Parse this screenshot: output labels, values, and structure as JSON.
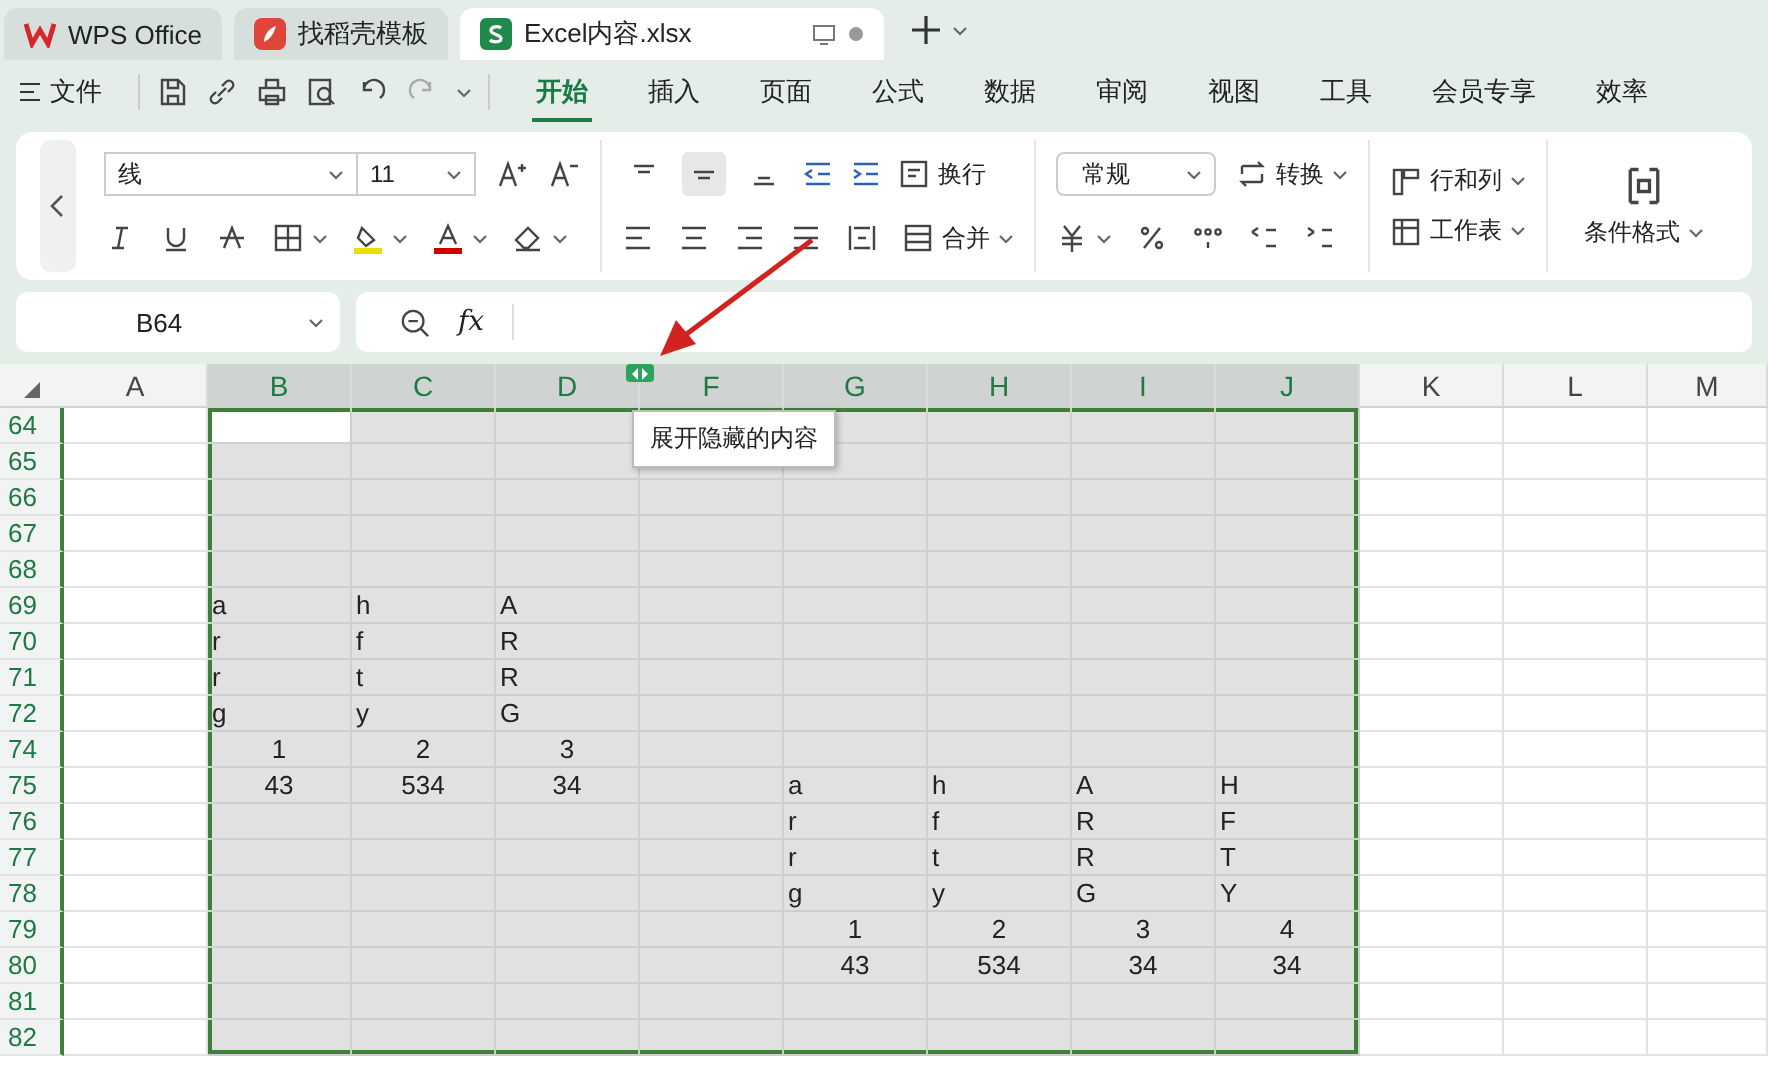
{
  "tabs": [
    {
      "label": "WPS Office",
      "kind": "wps",
      "selected": false
    },
    {
      "label": "找稻壳模板",
      "kind": "docer",
      "selected": false
    },
    {
      "label": "Excel内容.xlsx",
      "kind": "sheet",
      "selected": true
    }
  ],
  "menu": {
    "file": "文件",
    "items": [
      {
        "label": "开始",
        "selected": true
      },
      {
        "label": "插入",
        "selected": false
      },
      {
        "label": "页面",
        "selected": false
      },
      {
        "label": "公式",
        "selected": false
      },
      {
        "label": "数据",
        "selected": false
      },
      {
        "label": "审阅",
        "selected": false
      },
      {
        "label": "视图",
        "selected": false
      },
      {
        "label": "工具",
        "selected": false
      },
      {
        "label": "会员专享",
        "selected": false
      },
      {
        "label": "效率",
        "selected": false
      }
    ]
  },
  "ribbon": {
    "font": "线",
    "size": "11",
    "vertical_align": [
      {
        "kind": "top",
        "selected": false
      },
      {
        "kind": "middle",
        "selected": true
      },
      {
        "kind": "bottom",
        "selected": false
      }
    ],
    "wrap": "换行",
    "merge": "合并",
    "number_format": "常规",
    "convert": "转换",
    "rows_columns": "行和列",
    "worksheet": "工作表",
    "conditional_format": "条件格式"
  },
  "formula_bar": {
    "name_box": "B64",
    "fx": "fx"
  },
  "grid": {
    "columns": [
      {
        "label": "A",
        "selected": false
      },
      {
        "label": "B",
        "selected": true
      },
      {
        "label": "C",
        "selected": true
      },
      {
        "label": "D",
        "selected": true
      },
      {
        "label": "F",
        "selected": true
      },
      {
        "label": "G",
        "selected": true
      },
      {
        "label": "H",
        "selected": true
      },
      {
        "label": "I",
        "selected": true
      },
      {
        "label": "J",
        "selected": true
      },
      {
        "label": "K",
        "selected": false
      },
      {
        "label": "L",
        "selected": false
      },
      {
        "label": "M",
        "selected": false
      }
    ],
    "rows": [
      {
        "number": "64",
        "selected": true,
        "cells": [
          null,
          {
            "kind": "empty",
            "active": true
          }
        ]
      },
      {
        "number": "65",
        "selected": true
      },
      {
        "number": "66",
        "selected": true
      },
      {
        "number": "67",
        "selected": true
      },
      {
        "number": "68",
        "selected": true
      },
      {
        "number": "69",
        "selected": true,
        "cells": [
          null,
          {
            "kind": "text",
            "text": "a"
          },
          {
            "kind": "text",
            "text": "h"
          },
          {
            "kind": "text",
            "text": "A"
          }
        ]
      },
      {
        "number": "70",
        "selected": true,
        "cells": [
          null,
          {
            "kind": "text",
            "text": "r"
          },
          {
            "kind": "text",
            "text": "f"
          },
          {
            "kind": "text",
            "text": "R"
          }
        ]
      },
      {
        "number": "71",
        "selected": true,
        "cells": [
          null,
          {
            "kind": "text",
            "text": "r"
          },
          {
            "kind": "text",
            "text": "t"
          },
          {
            "kind": "text",
            "text": "R"
          }
        ]
      },
      {
        "number": "72",
        "selected": true,
        "cells": [
          null,
          {
            "kind": "text",
            "text": "g"
          },
          {
            "kind": "text",
            "text": "y"
          },
          {
            "kind": "text",
            "text": "G"
          }
        ]
      },
      {
        "number": "74",
        "selected": true,
        "cells": [
          null,
          {
            "kind": "number",
            "text": "1"
          },
          {
            "kind": "number",
            "text": "2"
          },
          {
            "kind": "number",
            "text": "3"
          }
        ]
      },
      {
        "number": "75",
        "selected": true,
        "cells": [
          null,
          {
            "kind": "number",
            "text": "43"
          },
          {
            "kind": "number",
            "text": "534"
          },
          {
            "kind": "number",
            "text": "34"
          },
          null,
          {
            "kind": "text",
            "text": "a"
          },
          {
            "kind": "text",
            "text": "h"
          },
          {
            "kind": "text",
            "text": "A"
          },
          {
            "kind": "text",
            "text": "H"
          }
        ]
      },
      {
        "number": "76",
        "selected": true,
        "cells": [
          null,
          null,
          null,
          null,
          null,
          {
            "kind": "text",
            "text": "r"
          },
          {
            "kind": "text",
            "text": "f"
          },
          {
            "kind": "text",
            "text": "R"
          },
          {
            "kind": "text",
            "text": "F"
          }
        ]
      },
      {
        "number": "77",
        "selected": true,
        "cells": [
          null,
          null,
          null,
          null,
          null,
          {
            "kind": "text",
            "text": "r"
          },
          {
            "kind": "text",
            "text": "t"
          },
          {
            "kind": "text",
            "text": "R"
          },
          {
            "kind": "text",
            "text": "T"
          }
        ]
      },
      {
        "number": "78",
        "selected": true,
        "cells": [
          null,
          null,
          null,
          null,
          null,
          {
            "kind": "text",
            "text": "g"
          },
          {
            "kind": "text",
            "text": "y"
          },
          {
            "kind": "text",
            "text": "G"
          },
          {
            "kind": "text",
            "text": "Y"
          }
        ]
      },
      {
        "number": "79",
        "selected": true,
        "cells": [
          null,
          null,
          null,
          null,
          null,
          {
            "kind": "number",
            "text": "1"
          },
          {
            "kind": "number",
            "text": "2"
          },
          {
            "kind": "number",
            "text": "3"
          },
          {
            "kind": "number",
            "text": "4"
          }
        ]
      },
      {
        "number": "80",
        "selected": true,
        "cells": [
          null,
          null,
          null,
          null,
          null,
          {
            "kind": "number",
            "text": "43"
          },
          {
            "kind": "number",
            "text": "534"
          },
          {
            "kind": "number",
            "text": "34"
          },
          {
            "kind": "number",
            "text": "34"
          }
        ]
      },
      {
        "number": "81",
        "selected": true
      },
      {
        "number": "82",
        "selected": true
      }
    ]
  },
  "tooltip": "展开隐藏的内容"
}
